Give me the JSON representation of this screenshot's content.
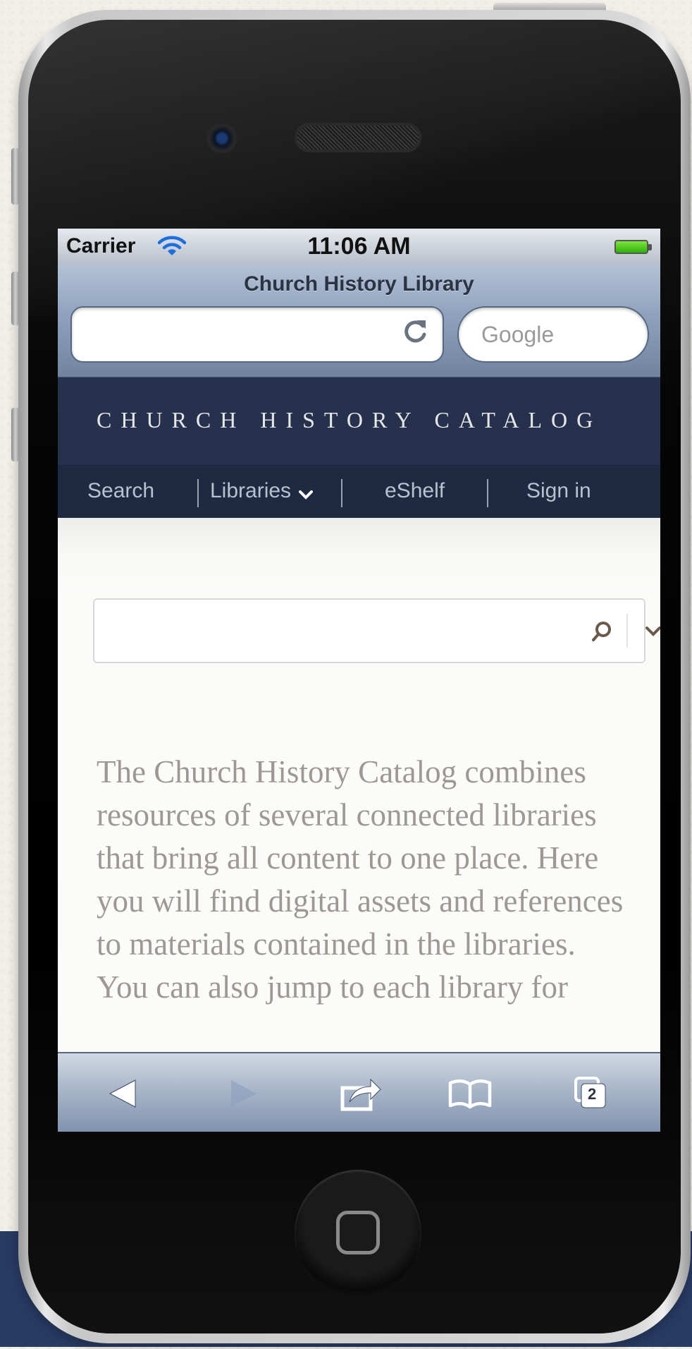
{
  "status_bar": {
    "carrier": "Carrier",
    "time": "11:06 AM",
    "wifi_icon": "wifi-icon",
    "battery_icon": "battery-icon"
  },
  "browser": {
    "page_title": "Church History Library",
    "url_value": "",
    "search_placeholder": "Google",
    "reload_icon": "reload-icon"
  },
  "site": {
    "title": "CHURCH HISTORY CATALOG",
    "nav": [
      {
        "label": "Search"
      },
      {
        "label": "Libraries"
      },
      {
        "label": "eShelf"
      },
      {
        "label": "Sign in"
      }
    ]
  },
  "search": {
    "value": "",
    "search_icon": "magnifier-icon",
    "dropdown_icon": "chevron-down-icon"
  },
  "intro_text": "The Church History Catalog combines resources of several connected libraries that bring all content to one place. Here you will find digital assets and references to materials contained in the libraries. You can also jump to each library for",
  "toolbar": {
    "back_icon": "back-arrow-icon",
    "forward_icon": "forward-arrow-icon",
    "share_icon": "share-icon",
    "bookmarks_icon": "bookmarks-icon",
    "tabs_count": "2"
  },
  "colors": {
    "header_navy": "#26324d",
    "nav_navy": "#1d2a42",
    "intro_text": "#9e9893",
    "browser_blue": "#8fa1bd"
  }
}
